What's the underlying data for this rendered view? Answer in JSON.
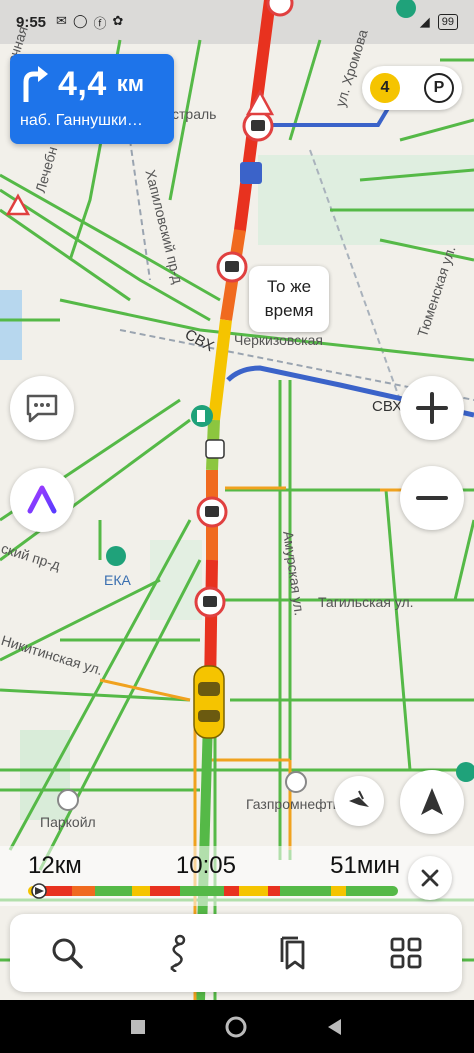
{
  "status_bar": {
    "time": "9:55",
    "icons": [
      "message-icon",
      "whatsapp-icon",
      "facebook-icon",
      "misc-icon"
    ],
    "battery": "99"
  },
  "maneuver": {
    "distance": "4,4",
    "unit": "км",
    "street": "наб. Ганнушки…",
    "icon": "turn-right-arrow-icon"
  },
  "speed_limit": "4",
  "parking_label": "P",
  "callout": {
    "line1": "То же",
    "line2": "время"
  },
  "map_labels": {
    "street_chkalova": "ул. Хромова",
    "estral": "страль",
    "lechebn": "Лечебн",
    "khapilovsky": "Хапиловский пр-д",
    "cherkizovskaya": "Черкизовская",
    "svh1": "СВХ",
    "svh2": "СВХ",
    "tyumenskaya": "Тюменская ул.",
    "amurskaya": "Амурская ул.",
    "tagilskaya": "Тагильская ул.",
    "nikitinskaya": "Никитинская ул.",
    "eka": "ЕКА",
    "gazpromneft": "Газпромнефть",
    "parkoil": "Паркойл",
    "proezd_d": "ский пр-д",
    "nizh": "ечная"
  },
  "route": {
    "distance": "12км",
    "eta": "10:05",
    "duration": "51мин"
  },
  "toolbar": {
    "search": "search-icon",
    "route": "route-icon",
    "bookmarks": "bookmark-icon",
    "menu": "grid-menu-icon"
  },
  "colors": {
    "maneuver_bg": "#1e74ea",
    "jam_red": "#e8321f",
    "jam_yellow": "#f5c400",
    "free_green": "#55b947",
    "blue_route": "#3b63c9"
  }
}
